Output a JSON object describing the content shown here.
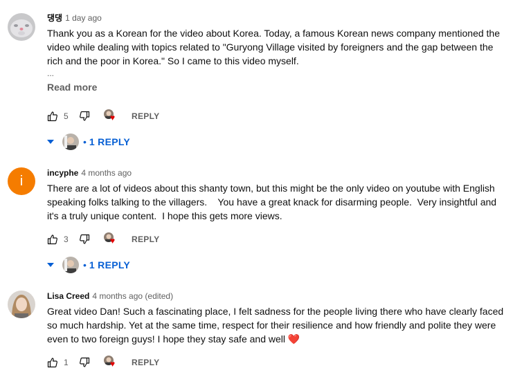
{
  "comments": [
    {
      "author": "댕댕",
      "time": "1 day ago",
      "text_lines": [
        "Thank you as a Korean for the video about Korea. Today, a famous Korean news company mentioned the",
        "video while dealing with topics related to \"Guryong Village visited by foreigners and the gap between the",
        "rich and the poor in Korea.\" So I came to this video myself."
      ],
      "ellipsis": "...",
      "read_more": "Read more",
      "likes": "5",
      "reply_label": "REPLY",
      "replies_label": "1 REPLY"
    },
    {
      "author": "incyphe",
      "avatar_letter": "i",
      "time": "4 months ago",
      "text_lines": [
        "There are a lot of videos about this shanty town, but this might be the only video on youtube with English",
        "speaking folks talking to the villagers.    You have a great knack for disarming people.  Very insightful and",
        "it's a truly unique content.  I hope this gets more views."
      ],
      "likes": "3",
      "reply_label": "REPLY",
      "replies_label": "1 REPLY"
    },
    {
      "author": "Lisa Creed",
      "time": "4 months ago (edited)",
      "text_lines": [
        "Great video Dan! Such a fascinating place, I felt sadness for the people living there who have clearly faced",
        "so much hardship. Yet at the same time, respect for their resilience and how friendly and polite they were",
        "even to two foreign guys! I hope they stay safe and well"
      ],
      "text_emoji": "❤️",
      "likes": "1",
      "reply_label": "REPLY"
    }
  ],
  "dot": "•",
  "colors": {
    "link": "#065fd4",
    "secondary": "#606060",
    "heart": "#e00000",
    "orange_avatar": "#f57c00"
  }
}
